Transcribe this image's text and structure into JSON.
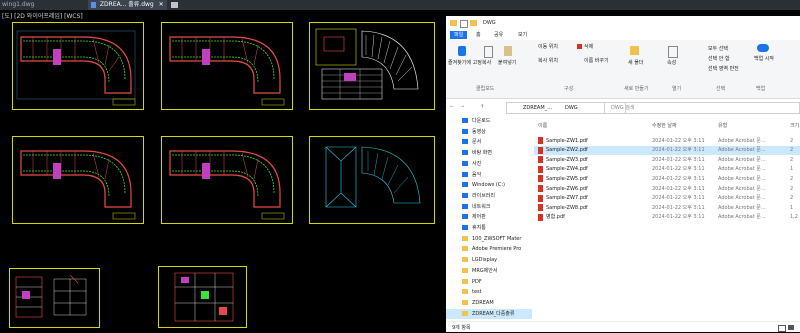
{
  "cad": {
    "tabs": [
      {
        "label": "wing1.dwg"
      },
      {
        "label": "ZDREA... 출류.dwg",
        "active": true,
        "close": "✕"
      }
    ],
    "view_label": "[도] [2D 와이어프레임] [WCS]"
  },
  "explorer": {
    "title": "DWG",
    "ribbon_tabs": [
      "파일",
      "홈",
      "공유",
      "보기"
    ],
    "clipboard": {
      "pin_label": "즐겨찾기에 고정",
      "copy_label": "복사",
      "paste_label": "붙여넣기",
      "group_label": "클립보드"
    },
    "organize": {
      "move_label": "이동 위치",
      "copy_to_label": "복사 위치",
      "delete_label": "삭제",
      "rename_label": "이름 바꾸기",
      "group_label": "구성"
    },
    "new": {
      "folder_label": "새 폴더",
      "group_label": "새로 만들기"
    },
    "open": {
      "properties_label": "속성",
      "group_label": "열기"
    },
    "select": {
      "all_label": "모두 선택",
      "none_label": "선택 안 함",
      "invert_label": "선택 영역 반전",
      "group_label": "선택"
    },
    "backup": {
      "label": "백업 시작",
      "group_label": "백업"
    },
    "address": [
      "ZDREAM_...",
      "DWG"
    ],
    "search_placeholder": "DWG 검색",
    "columns": {
      "name": "이름",
      "modified": "수정한 날짜",
      "type": "유형",
      "size": "크기"
    },
    "files": [
      {
        "name": "Sample-ZW1.pdf",
        "date": "2024-01-22 오후 3:11",
        "type": "Adobe Acrobat 문...",
        "size": "2"
      },
      {
        "name": "Sample-ZW2.pdf",
        "date": "2024-01-22 오후 3:11",
        "type": "Adobe Acrobat 문...",
        "size": "2",
        "selected": true
      },
      {
        "name": "Sample-ZW3.pdf",
        "date": "2024-01-22 오후 3:11",
        "type": "Adobe Acrobat 문...",
        "size": "2"
      },
      {
        "name": "Sample-ZW4.pdf",
        "date": "2024-01-22 오후 3:11",
        "type": "Adobe Acrobat 문...",
        "size": "1"
      },
      {
        "name": "Sample-ZW5.pdf",
        "date": "2024-01-22 오후 3:11",
        "type": "Adobe Acrobat 문...",
        "size": "2"
      },
      {
        "name": "Sample-ZW6.pdf",
        "date": "2024-01-22 오후 3:11",
        "type": "Adobe Acrobat 문...",
        "size": "2"
      },
      {
        "name": "Sample-ZW7.pdf",
        "date": "2024-01-22 오후 3:11",
        "type": "Adobe Acrobat 문...",
        "size": "2"
      },
      {
        "name": "Sample-ZW8.pdf",
        "date": "2024-01-22 오후 3:11",
        "type": "Adobe Acrobat 문...",
        "size": "1"
      },
      {
        "name": "병합.pdf",
        "date": "2024-01-22 오후 3:11",
        "type": "Adobe Acrobat 문...",
        "size": "1,2"
      }
    ],
    "nav_items": [
      {
        "label": "다운로드",
        "icon": "download-icon"
      },
      {
        "label": "동영상",
        "icon": "video-icon"
      },
      {
        "label": "문서",
        "icon": "document-icon"
      },
      {
        "label": "바탕 화면",
        "icon": "desktop-icon"
      },
      {
        "label": "사진",
        "icon": "picture-icon"
      },
      {
        "label": "음악",
        "icon": "music-icon"
      },
      {
        "label": "Windows (C:)",
        "icon": "drive-icon"
      },
      {
        "label": "라이브러리",
        "icon": "library-icon"
      },
      {
        "label": "네트워크",
        "icon": "network-icon"
      },
      {
        "label": "제어판",
        "icon": "control-panel-icon"
      },
      {
        "label": "휴지통",
        "icon": "recycle-bin-icon"
      },
      {
        "label": "100_ZWSOFT Mater",
        "icon": "folder-icon"
      },
      {
        "label": "Adobe Premiere Pro",
        "icon": "folder-icon"
      },
      {
        "label": "LGDisplay",
        "icon": "folder-icon"
      },
      {
        "label": "MRG제안서",
        "icon": "folder-icon"
      },
      {
        "label": "PDF",
        "icon": "folder-icon"
      },
      {
        "label": "test",
        "icon": "folder-icon"
      },
      {
        "label": "ZDREAM",
        "icon": "folder-icon"
      },
      {
        "label": "ZDREAM_다중출류",
        "icon": "folder-icon",
        "selected": true
      }
    ],
    "status": "9개 항목",
    "colors": {
      "accent": "#1a73e8",
      "pdf": "#d93025",
      "folder": "#f2c14e",
      "selection": "#cce8ff"
    }
  }
}
